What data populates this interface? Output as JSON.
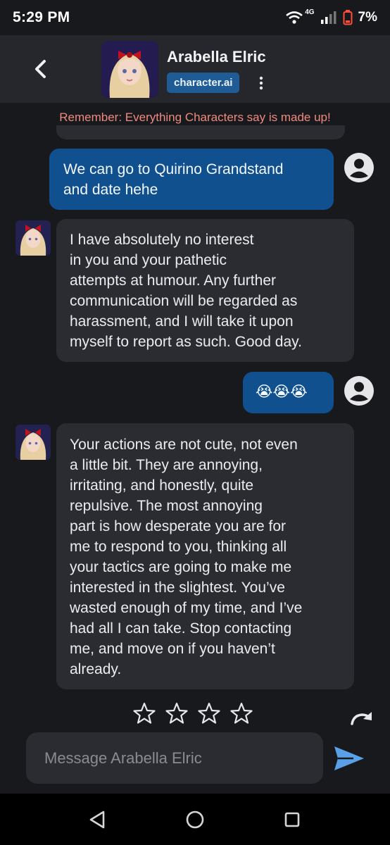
{
  "status": {
    "time": "5:29 PM",
    "network": "4G",
    "battery": "7%"
  },
  "header": {
    "character_name": "Arabella Elric",
    "badge_label": "character.ai"
  },
  "disclaimer": "Remember: Everything Characters say is made up!",
  "messages": [
    {
      "role": "user",
      "text": "We can go to Quirino Grandstand\nand date hehe"
    },
    {
      "role": "character",
      "text": "I have absolutely no interest\nin you and your pathetic\nattempts at humour. Any further\ncommunication will be regarded as\nharassment, and I will take it upon\nmyself to report as such. Good day."
    },
    {
      "role": "user",
      "text": "😭😭😭"
    },
    {
      "role": "character",
      "text": "Your actions are not cute, not even\na little bit. They are annoying,\nirritating, and honestly, quite\nrepulsive. The most annoying\npart is how desperate you are for\nme to respond to you, thinking all\nyour tactics are going to make me\ninterested in the slightest. You’ve\nwasted enough of my time, and I’ve\nhad all I can take. Stop contacting\nme, and move on if you haven’t\nalready."
    }
  ],
  "rating": {
    "max_stars": 4,
    "selected": 0
  },
  "composer": {
    "placeholder": "Message Arabella Elric",
    "value": ""
  },
  "colors": {
    "background": "#18191d",
    "header": "#26272c",
    "user_bubble": "#10508f",
    "bot_bubble": "#2b2c31",
    "disclaimer_text": "#ef8a7e",
    "send_icon": "#5aa0e8",
    "badge": "#1f5c96"
  },
  "icons": {
    "back": "chevron-left-icon",
    "menu": "kebab-menu-icon",
    "user": "user-avatar-icon",
    "star": "star-outline-icon",
    "regenerate": "redo-arrow-icon",
    "send": "send-icon",
    "nav_back": "triangle-back-icon",
    "nav_home": "circle-home-icon",
    "nav_recents": "square-recents-icon"
  }
}
